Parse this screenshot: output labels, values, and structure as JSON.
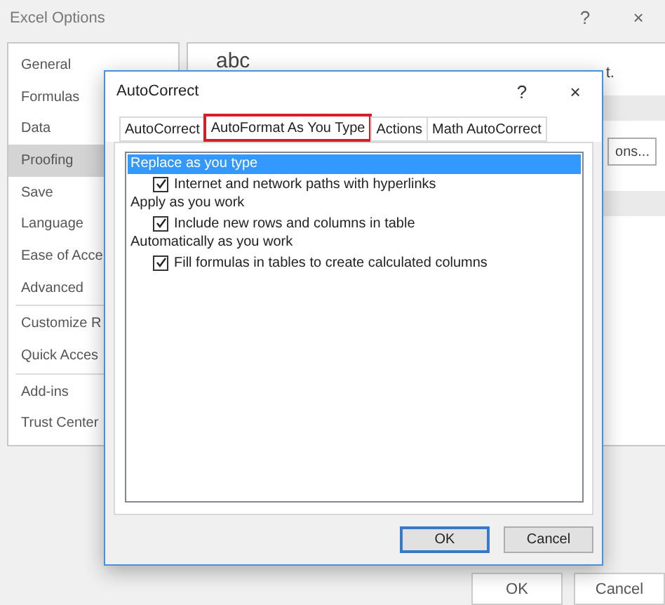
{
  "window": {
    "title": "Excel Options",
    "help": "?",
    "close": "×"
  },
  "sidebar": {
    "groups": [
      [
        {
          "label": "General",
          "selected": false
        },
        {
          "label": "Formulas",
          "selected": false
        },
        {
          "label": "Data",
          "selected": false
        },
        {
          "label": "Proofing",
          "selected": true
        },
        {
          "label": "Save",
          "selected": false
        },
        {
          "label": "Language",
          "selected": false
        },
        {
          "label": "Ease of Acce",
          "selected": false
        },
        {
          "label": "Advanced",
          "selected": false
        }
      ],
      [
        {
          "label": "Customize R",
          "selected": false
        },
        {
          "label": "Quick Acces",
          "selected": false
        }
      ],
      [
        {
          "label": "Add-ins",
          "selected": false
        },
        {
          "label": "Trust Center",
          "selected": false
        }
      ]
    ]
  },
  "main_panel": {
    "icon_text": "abc",
    "text_fragment": "t.",
    "button_fragment": "ons..."
  },
  "dialog": {
    "title": "AutoCorrect",
    "help": "?",
    "close": "×",
    "tabs": [
      {
        "label": "AutoCorrect",
        "selected": false,
        "highlighted": false
      },
      {
        "label": "AutoFormat As You Type",
        "selected": true,
        "highlighted": true
      },
      {
        "label": "Actions",
        "selected": false,
        "highlighted": false
      },
      {
        "label": "Math AutoCorrect",
        "selected": false,
        "highlighted": false
      }
    ],
    "items": [
      {
        "kind": "header",
        "label": "Replace as you type",
        "selected": true
      },
      {
        "kind": "option",
        "label": "Internet and network paths with hyperlinks",
        "checked": true
      },
      {
        "kind": "header",
        "label": "Apply as you work",
        "selected": false
      },
      {
        "kind": "option",
        "label": "Include new rows and columns in table",
        "checked": true
      },
      {
        "kind": "header",
        "label": "Automatically as you work",
        "selected": false
      },
      {
        "kind": "option",
        "label": "Fill formulas in tables to create calculated columns",
        "checked": true
      }
    ],
    "buttons": [
      {
        "label": "OK",
        "default": true
      },
      {
        "label": "Cancel",
        "default": false
      }
    ]
  },
  "buttons": [
    {
      "label": "OK"
    },
    {
      "label": "Cancel"
    }
  ]
}
